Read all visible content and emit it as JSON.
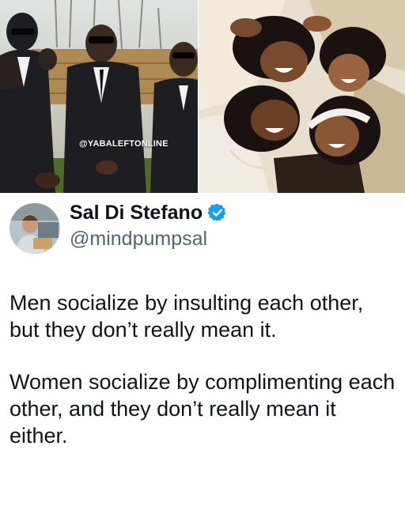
{
  "photos": {
    "left": {
      "description_icon": "men-in-suits-photo",
      "watermark": "@YABALEFTONLINE"
    },
    "right": {
      "description_icon": "women-lying-in-circle-photo"
    }
  },
  "post": {
    "author": {
      "display_name": "Sal Di Stefano",
      "handle": "@mindpumpsal",
      "avatar_icon": "profile-avatar",
      "verified_icon": "verified-badge-icon",
      "verified_color": "#1d9bf0"
    },
    "paragraphs": [
      "Men socialize by insulting each other, but they don’t really mean it.",
      "Women socialize by complimenting each other, and they don’t really mean it either."
    ]
  },
  "colors": {
    "text": "#0f1419",
    "secondary_text": "#536471",
    "background": "#ffffff"
  }
}
